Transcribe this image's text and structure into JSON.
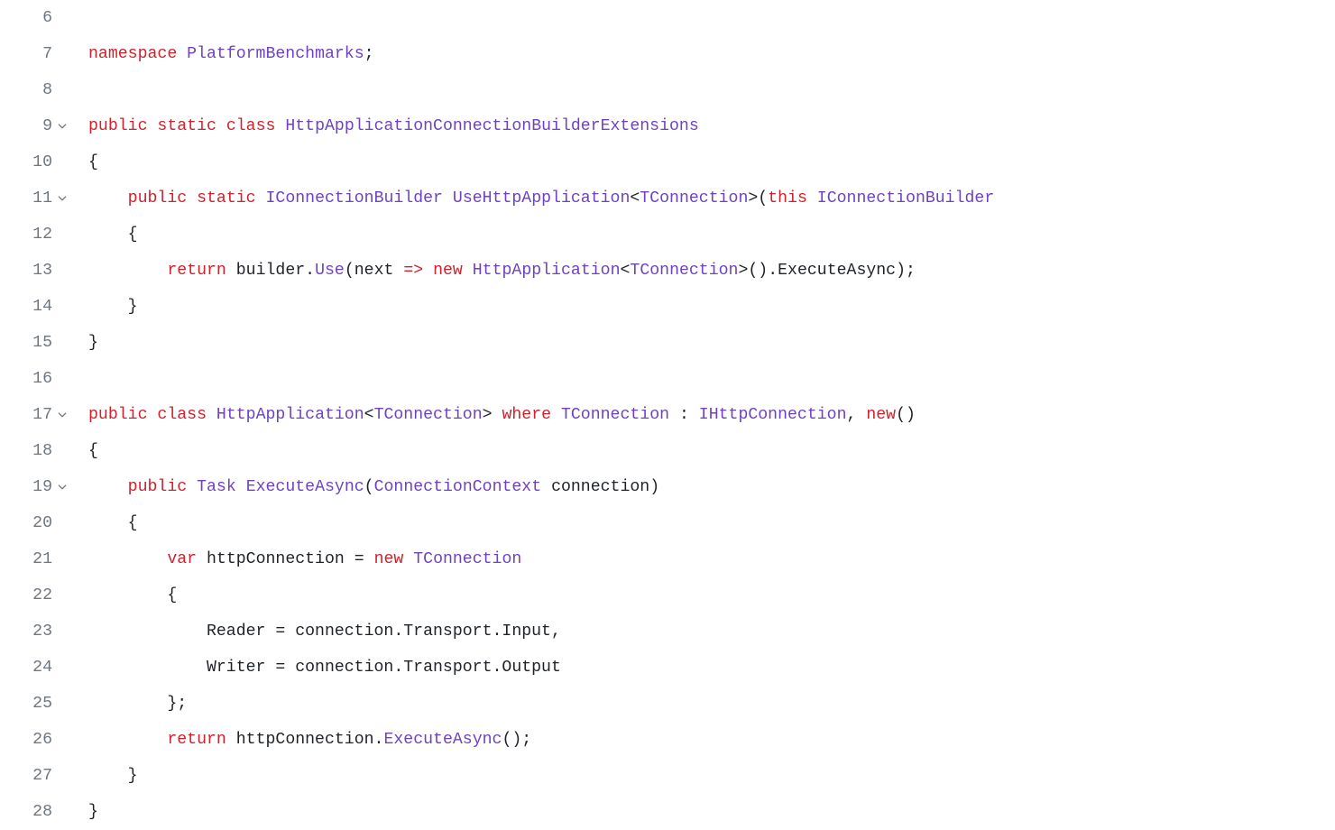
{
  "lines": [
    {
      "num": "6",
      "fold": false,
      "tokens": []
    },
    {
      "num": "7",
      "fold": false,
      "tokens": [
        {
          "c": "kw",
          "t": "namespace"
        },
        {
          "c": "pln",
          "t": " "
        },
        {
          "c": "type",
          "t": "PlatformBenchmarks"
        },
        {
          "c": "pln",
          "t": ";"
        }
      ]
    },
    {
      "num": "8",
      "fold": false,
      "tokens": []
    },
    {
      "num": "9",
      "fold": true,
      "tokens": [
        {
          "c": "kw",
          "t": "public"
        },
        {
          "c": "pln",
          "t": " "
        },
        {
          "c": "kw",
          "t": "static"
        },
        {
          "c": "pln",
          "t": " "
        },
        {
          "c": "kw",
          "t": "class"
        },
        {
          "c": "pln",
          "t": " "
        },
        {
          "c": "type",
          "t": "HttpApplicationConnectionBuilderExtensions"
        }
      ]
    },
    {
      "num": "10",
      "fold": false,
      "tokens": [
        {
          "c": "pln",
          "t": "{"
        }
      ]
    },
    {
      "num": "11",
      "fold": true,
      "tokens": [
        {
          "c": "pln",
          "t": "    "
        },
        {
          "c": "kw",
          "t": "public"
        },
        {
          "c": "pln",
          "t": " "
        },
        {
          "c": "kw",
          "t": "static"
        },
        {
          "c": "pln",
          "t": " "
        },
        {
          "c": "type",
          "t": "IConnectionBuilder"
        },
        {
          "c": "pln",
          "t": " "
        },
        {
          "c": "fn",
          "t": "UseHttpApplication"
        },
        {
          "c": "pln",
          "t": "<"
        },
        {
          "c": "type",
          "t": "TConnection"
        },
        {
          "c": "pln",
          "t": ">("
        },
        {
          "c": "kw",
          "t": "this"
        },
        {
          "c": "pln",
          "t": " "
        },
        {
          "c": "type",
          "t": "IConnectionBuilder"
        }
      ]
    },
    {
      "num": "12",
      "fold": false,
      "tokens": [
        {
          "c": "pln",
          "t": "    {"
        }
      ]
    },
    {
      "num": "13",
      "fold": false,
      "tokens": [
        {
          "c": "pln",
          "t": "        "
        },
        {
          "c": "kw",
          "t": "return"
        },
        {
          "c": "pln",
          "t": " builder."
        },
        {
          "c": "fn",
          "t": "Use"
        },
        {
          "c": "pln",
          "t": "("
        },
        {
          "c": "pln",
          "t": "next"
        },
        {
          "c": "pln",
          "t": " "
        },
        {
          "c": "op",
          "t": "=>"
        },
        {
          "c": "pln",
          "t": " "
        },
        {
          "c": "kw",
          "t": "new"
        },
        {
          "c": "pln",
          "t": " "
        },
        {
          "c": "type",
          "t": "HttpApplication"
        },
        {
          "c": "pln",
          "t": "<"
        },
        {
          "c": "type",
          "t": "TConnection"
        },
        {
          "c": "pln",
          "t": ">().ExecuteAsync);"
        }
      ]
    },
    {
      "num": "14",
      "fold": false,
      "tokens": [
        {
          "c": "pln",
          "t": "    }"
        }
      ]
    },
    {
      "num": "15",
      "fold": false,
      "tokens": [
        {
          "c": "pln",
          "t": "}"
        }
      ]
    },
    {
      "num": "16",
      "fold": false,
      "tokens": []
    },
    {
      "num": "17",
      "fold": true,
      "tokens": [
        {
          "c": "kw",
          "t": "public"
        },
        {
          "c": "pln",
          "t": " "
        },
        {
          "c": "kw",
          "t": "class"
        },
        {
          "c": "pln",
          "t": " "
        },
        {
          "c": "type",
          "t": "HttpApplication"
        },
        {
          "c": "pln",
          "t": "<"
        },
        {
          "c": "type",
          "t": "TConnection"
        },
        {
          "c": "pln",
          "t": "> "
        },
        {
          "c": "kw",
          "t": "where"
        },
        {
          "c": "pln",
          "t": " "
        },
        {
          "c": "type",
          "t": "TConnection"
        },
        {
          "c": "pln",
          "t": " : "
        },
        {
          "c": "type",
          "t": "IHttpConnection"
        },
        {
          "c": "pln",
          "t": ", "
        },
        {
          "c": "kw",
          "t": "new"
        },
        {
          "c": "pln",
          "t": "()"
        }
      ]
    },
    {
      "num": "18",
      "fold": false,
      "tokens": [
        {
          "c": "pln",
          "t": "{"
        }
      ]
    },
    {
      "num": "19",
      "fold": true,
      "tokens": [
        {
          "c": "pln",
          "t": "    "
        },
        {
          "c": "kw",
          "t": "public"
        },
        {
          "c": "pln",
          "t": " "
        },
        {
          "c": "type",
          "t": "Task"
        },
        {
          "c": "pln",
          "t": " "
        },
        {
          "c": "fn",
          "t": "ExecuteAsync"
        },
        {
          "c": "pln",
          "t": "("
        },
        {
          "c": "type",
          "t": "ConnectionContext"
        },
        {
          "c": "pln",
          "t": " "
        },
        {
          "c": "pln",
          "t": "connection"
        },
        {
          "c": "pln",
          "t": ")"
        }
      ]
    },
    {
      "num": "20",
      "fold": false,
      "tokens": [
        {
          "c": "pln",
          "t": "    {"
        }
      ]
    },
    {
      "num": "21",
      "fold": false,
      "tokens": [
        {
          "c": "pln",
          "t": "        "
        },
        {
          "c": "kw",
          "t": "var"
        },
        {
          "c": "pln",
          "t": " "
        },
        {
          "c": "pln",
          "t": "httpConnection"
        },
        {
          "c": "pln",
          "t": " = "
        },
        {
          "c": "kw",
          "t": "new"
        },
        {
          "c": "pln",
          "t": " "
        },
        {
          "c": "type",
          "t": "TConnection"
        }
      ]
    },
    {
      "num": "22",
      "fold": false,
      "tokens": [
        {
          "c": "pln",
          "t": "        {"
        }
      ]
    },
    {
      "num": "23",
      "fold": false,
      "tokens": [
        {
          "c": "pln",
          "t": "            Reader = connection.Transport.Input,"
        }
      ]
    },
    {
      "num": "24",
      "fold": false,
      "tokens": [
        {
          "c": "pln",
          "t": "            Writer = connection.Transport.Output"
        }
      ]
    },
    {
      "num": "25",
      "fold": false,
      "tokens": [
        {
          "c": "pln",
          "t": "        };"
        }
      ]
    },
    {
      "num": "26",
      "fold": false,
      "tokens": [
        {
          "c": "pln",
          "t": "        "
        },
        {
          "c": "kw",
          "t": "return"
        },
        {
          "c": "pln",
          "t": " httpConnection."
        },
        {
          "c": "fn",
          "t": "ExecuteAsync"
        },
        {
          "c": "pln",
          "t": "();"
        }
      ]
    },
    {
      "num": "27",
      "fold": false,
      "tokens": [
        {
          "c": "pln",
          "t": "    }"
        }
      ]
    },
    {
      "num": "28",
      "fold": false,
      "tokens": [
        {
          "c": "pln",
          "t": "}"
        }
      ]
    }
  ]
}
